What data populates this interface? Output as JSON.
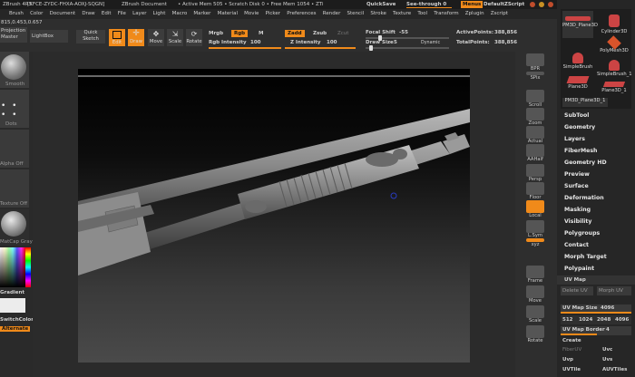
{
  "title_bar": {
    "app": "ZBrush 4R5",
    "serial": "[XFCE-ZYDC-FHXA-AOXJ-SQGN]",
    "document": "ZBrush Document",
    "status": "• Active Mem 505 • Scratch Disk 0 • Free Mem 1054 • ZTi",
    "quicksave": "QuickSave",
    "see_through": "See-through  0",
    "menus": "Menus",
    "script": "DefaultZScript"
  },
  "menu_bar": [
    "Brush",
    "Color",
    "Document",
    "Draw",
    "Edit",
    "File",
    "Layer",
    "Light",
    "Macro",
    "Marker",
    "Material",
    "Movie",
    "Picker",
    "Preferences",
    "Render",
    "Stencil",
    "Stroke",
    "Texture",
    "Tool",
    "Transform",
    "Zplugin",
    "Zscript"
  ],
  "left_top": {
    "coords": "815,0.453,0.657",
    "projection": "Projection",
    "master": "Master",
    "lightbox": "LightBox"
  },
  "toolbar": {
    "quick_sketch": "Quick Sketch",
    "buttons": [
      "Edit",
      "Draw",
      "Move",
      "Scale",
      "Rotate"
    ],
    "mrgb": "Mrgb",
    "rgb": "Rgb",
    "m": "M",
    "zadd": "Zadd",
    "zsub": "Zsub",
    "zcut": "Zcut",
    "rgb_intensity_label": "Rgb Intensity",
    "rgb_intensity": "100",
    "z_intensity_label": "Z Intensity",
    "z_intensity": "100",
    "focal_shift_label": "Focal Shift",
    "focal_shift": "-55",
    "draw_size_label": "Draw Size",
    "draw_size": "5",
    "dynamic": "Dynamic",
    "active_points_label": "ActivePoints:",
    "active_points": "388,856",
    "total_points_label": "TotalPoints:",
    "total_points": "388,856"
  },
  "left_shelf": {
    "brush": "Smooth",
    "stroke": "Dots",
    "alpha": "Alpha Off",
    "texture": "Texture Off",
    "material": "MatCap Gray",
    "gradient": "Gradient",
    "switch_color": "SwitchColor",
    "alternate": "Alternate"
  },
  "right_shelf": [
    "BPR",
    "SPix",
    "Scroll",
    "Zoom",
    "Actual",
    "AAHalf",
    "Persp",
    "Floor",
    "Local",
    "L.Sym",
    "xyz",
    "Frame",
    "Move",
    "Scale",
    "Rotate"
  ],
  "right_panel": {
    "tools": [
      "PM3D_Plane3D",
      "Cylinder3D",
      "PolyMesh3D",
      "SimpleBrush",
      "SimpleBrush_1",
      "Plane3D",
      "Plane3D_1",
      "PM3D_Plane3D_1"
    ],
    "menu": [
      "SubTool",
      "Geometry",
      "Layers",
      "FiberMesh",
      "Geometry HD",
      "Preview",
      "Surface",
      "Deformation",
      "Masking",
      "Visibility",
      "Polygroups",
      "Contact",
      "Morph Target",
      "Polypaint"
    ],
    "uv_map": {
      "title": "UV Map",
      "delete_uv": "Delete UV",
      "morph_uv": "Morph UV",
      "size_label": "UV Map Size",
      "size": "4096",
      "sizes": [
        "512",
        "1024",
        "2048",
        "4096"
      ],
      "border_label": "UV Map Border",
      "border": "4",
      "create": "Create",
      "row1": [
        "FiberUV",
        "Uvc"
      ],
      "row2": [
        "Uvp",
        "Uvs"
      ],
      "row3": [
        "UVTile",
        "AUVTiles"
      ]
    }
  },
  "colors": {
    "accent": "#f08a1a",
    "panel": "#262626",
    "viewport_top": "#000000"
  }
}
